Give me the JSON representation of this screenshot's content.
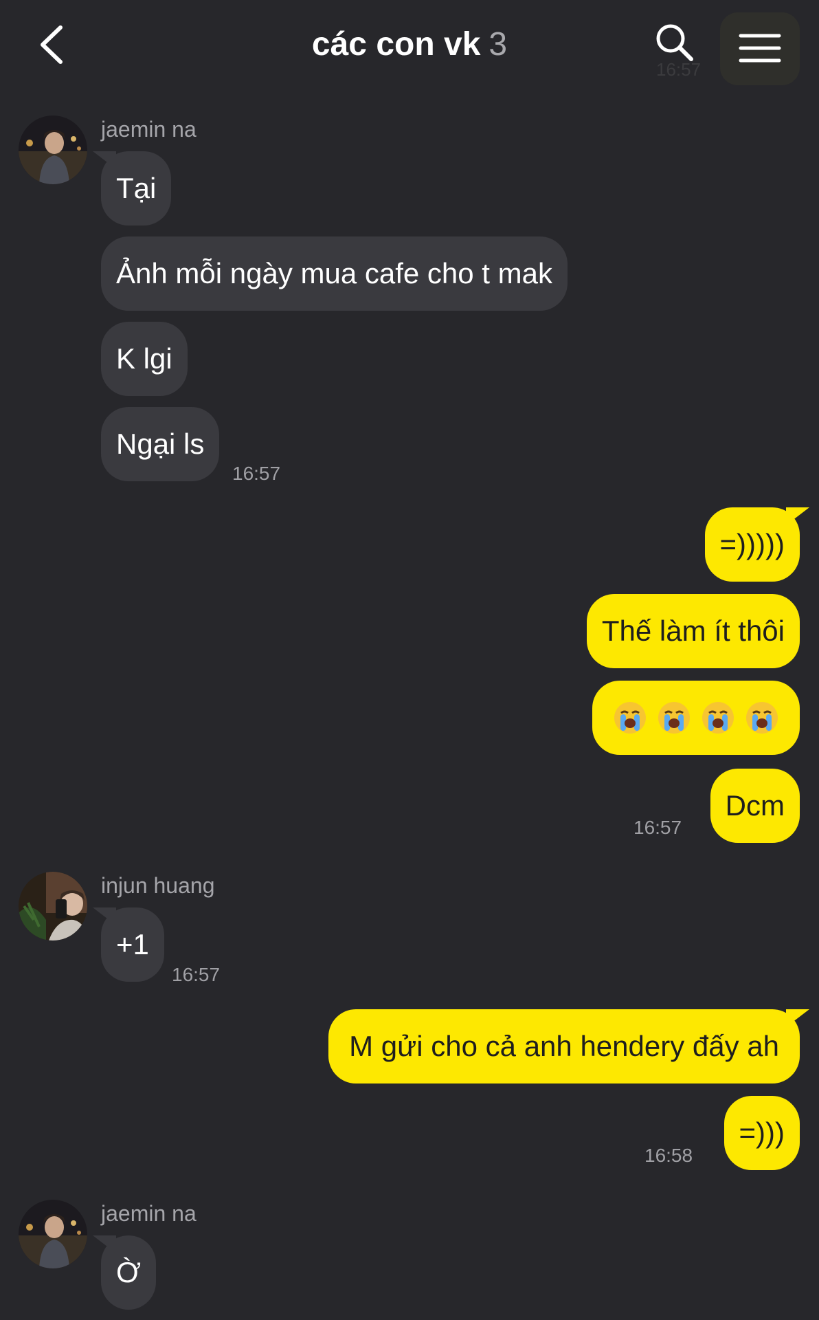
{
  "header": {
    "title": "các con vk",
    "member_count": "3",
    "ghost_time": "16:57",
    "icons": [
      "chevron-left-icon",
      "search-icon",
      "hamburger-menu-icon"
    ]
  },
  "colors": {
    "background": "#27272b",
    "incoming_bubble": "#3a3a3f",
    "outgoing_bubble": "#fde801",
    "timestamp": "#a0a0a5"
  },
  "messages": [
    {
      "sender": "jaemin na",
      "texts": [
        "Tại",
        "Ảnh mỗi ngày mua cafe cho t mak",
        "K lgi",
        "Ngại ls"
      ],
      "time": "16:57"
    },
    {
      "sender": "me",
      "texts": [
        "=)))))",
        "Thế làm ít thôi",
        "😭😭😭😭",
        "Dcm"
      ],
      "time": "16:57"
    },
    {
      "sender": "injun huang",
      "texts": [
        "+1"
      ],
      "time": "16:57"
    },
    {
      "sender": "me",
      "texts": [
        "M gửi cho cả anh hendery đấy ah",
        "=)))"
      ],
      "time": "16:58"
    },
    {
      "sender": "jaemin na",
      "texts": [
        "Ờ"
      ]
    }
  ]
}
